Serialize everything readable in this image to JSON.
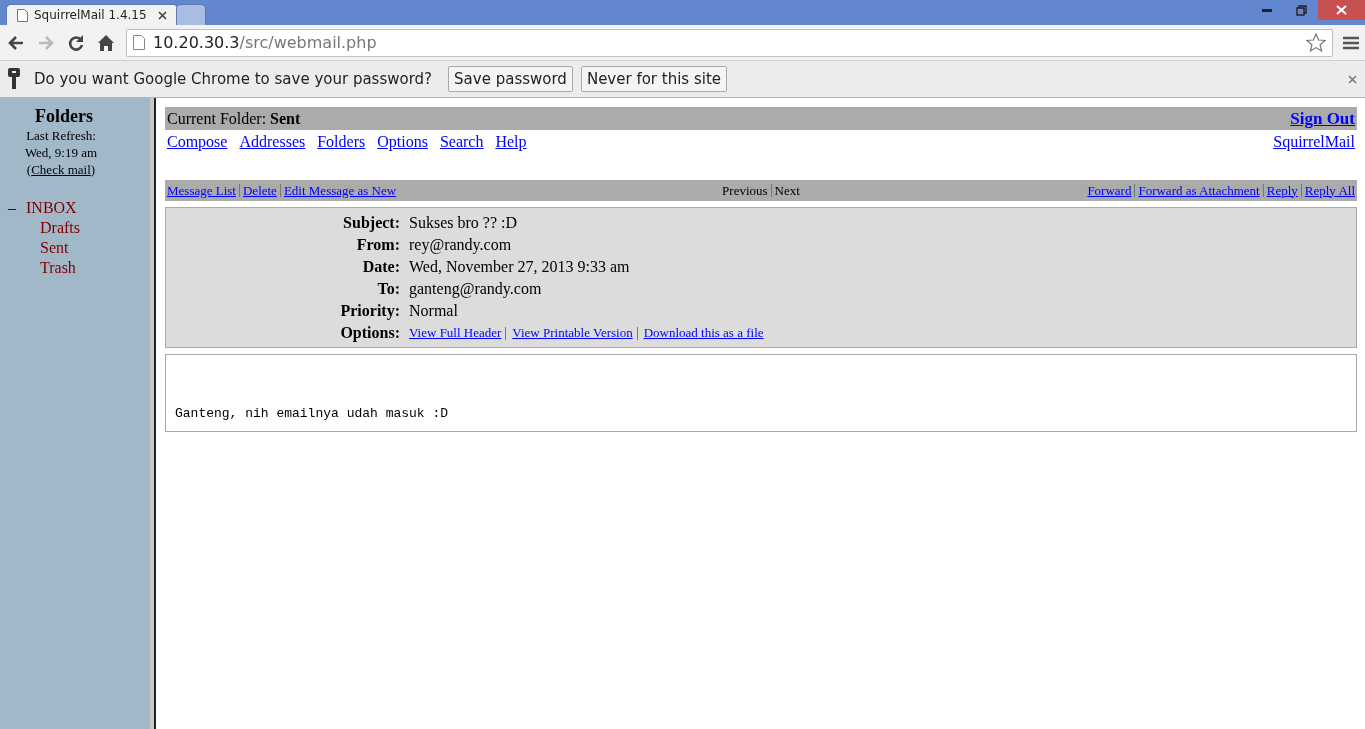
{
  "browser": {
    "tabs": [
      {
        "title": "SquirrelMail 1.4.15",
        "selected": true
      },
      {
        "selected": false
      }
    ],
    "address": {
      "host": "10.20.30.3",
      "path": "/src/webmail.php"
    },
    "infobar": {
      "message": "Do you want Google Chrome to save your password?",
      "buttons": [
        "Save password",
        "Never for this site"
      ]
    }
  },
  "sidebar": {
    "title": "Folders",
    "refresh_label": "Last Refresh:",
    "refresh_time": "Wed, 9:19 am",
    "check_mail": {
      "open": "(",
      "link": "Check mail",
      "close": ")"
    },
    "folders": [
      {
        "name": "INBOX",
        "toggle": "–",
        "expanded": true,
        "children": [
          {
            "name": "Drafts"
          },
          {
            "name": "Sent"
          },
          {
            "name": "Trash"
          }
        ]
      }
    ]
  },
  "header": {
    "folder_label": "Current Folder:",
    "folder": "Sent",
    "sign_out": "Sign Out",
    "nav": [
      "Compose",
      "Addresses",
      "Folders",
      "Options",
      "Search",
      "Help"
    ],
    "brand": "SquirrelMail"
  },
  "message_toolbar": {
    "left": [
      "Message List",
      "Delete",
      "Edit Message as New"
    ],
    "center": [
      "Previous",
      "Next"
    ],
    "right": [
      "Forward",
      "Forward as Attachment",
      "Reply",
      "Reply All"
    ]
  },
  "message_headers": [
    {
      "label": "Subject:",
      "value": "Sukses bro ?? :D"
    },
    {
      "label": "From:",
      "value": "rey@randy.com"
    },
    {
      "label": "Date:",
      "value": "Wed, November 27, 2013 9:33 am"
    },
    {
      "label": "To:",
      "value": "ganteng@randy.com"
    },
    {
      "label": "Priority:",
      "value": "Normal"
    }
  ],
  "options": {
    "label": "Options:",
    "links": [
      "View Full Header",
      "View Printable Version",
      "Download this as a file"
    ]
  },
  "body": "Ganteng, nih emailnya udah masuk :D"
}
